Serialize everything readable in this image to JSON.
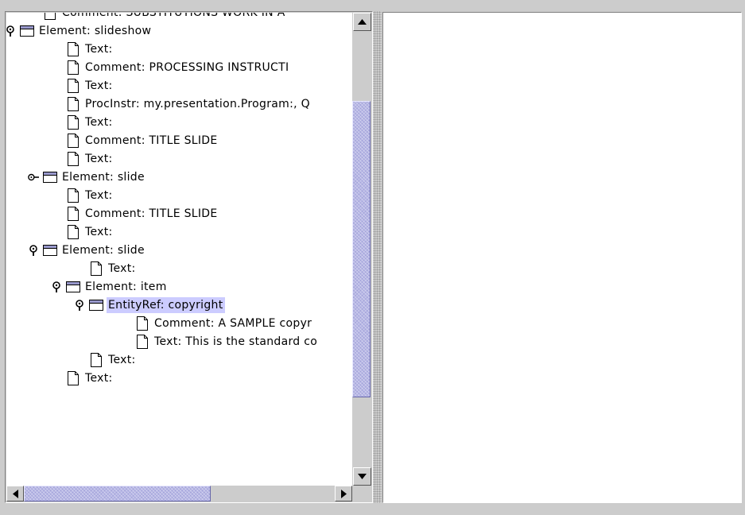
{
  "tree": {
    "rows": [
      {
        "label": "Comment: SUBSTITUTIONS WORK IN A",
        "type": "leaf",
        "handle": "none",
        "depth": 1
      },
      {
        "label": "Element: slideshow",
        "type": "folder",
        "handle": "expanded",
        "depth": 0
      },
      {
        "label": "Text:",
        "type": "leaf",
        "handle": "none",
        "depth": 2
      },
      {
        "label": "Comment: PROCESSING INSTRUCTI",
        "type": "leaf",
        "handle": "none",
        "depth": 2
      },
      {
        "label": "Text:",
        "type": "leaf",
        "handle": "none",
        "depth": 2
      },
      {
        "label": "ProcInstr: my.presentation.Program:, Q",
        "type": "leaf",
        "handle": "none",
        "depth": 2
      },
      {
        "label": "Text:",
        "type": "leaf",
        "handle": "none",
        "depth": 2
      },
      {
        "label": "Comment: TITLE SLIDE",
        "type": "leaf",
        "handle": "none",
        "depth": 2
      },
      {
        "label": "Text:",
        "type": "leaf",
        "handle": "none",
        "depth": 2
      },
      {
        "label": "Element: slide",
        "type": "folder",
        "handle": "collapsed",
        "depth": 1
      },
      {
        "label": "Text:",
        "type": "leaf",
        "handle": "none",
        "depth": 2
      },
      {
        "label": "Comment: TITLE SLIDE",
        "type": "leaf",
        "handle": "none",
        "depth": 2
      },
      {
        "label": "Text:",
        "type": "leaf",
        "handle": "none",
        "depth": 2
      },
      {
        "label": "Element: slide",
        "type": "folder",
        "handle": "expanded",
        "depth": 1
      },
      {
        "label": "Text:",
        "type": "leaf",
        "handle": "none",
        "depth": 3
      },
      {
        "label": "Element: item",
        "type": "folder",
        "handle": "expanded",
        "depth": 2
      },
      {
        "label": "EntityRef: copyright",
        "type": "folder",
        "handle": "expanded",
        "depth": 3,
        "selected": true
      },
      {
        "label": "Comment: A SAMPLE copyr",
        "type": "leaf",
        "handle": "none",
        "depth": 5
      },
      {
        "label": "Text: This is the standard co",
        "type": "leaf",
        "handle": "none",
        "depth": 5
      },
      {
        "label": "Text:",
        "type": "leaf",
        "handle": "none",
        "depth": 3
      },
      {
        "label": "Text:",
        "type": "leaf",
        "handle": "none",
        "depth": 2
      }
    ]
  },
  "scrollbars": {
    "vertical": {
      "position": 0.16,
      "visible_fraction": 0.68
    },
    "horizontal": {
      "position": 0.0,
      "visible_fraction": 0.6
    }
  },
  "colors": {
    "selection": "#ccccff",
    "thumb": "#b8b8e6",
    "panel_bg": "#cccccc",
    "folder_tab": "#9999cc"
  },
  "icons": {
    "leaf": "document-icon",
    "folder": "folder-icon",
    "expanded": "key-expanded-icon",
    "collapsed": "key-collapsed-icon"
  }
}
